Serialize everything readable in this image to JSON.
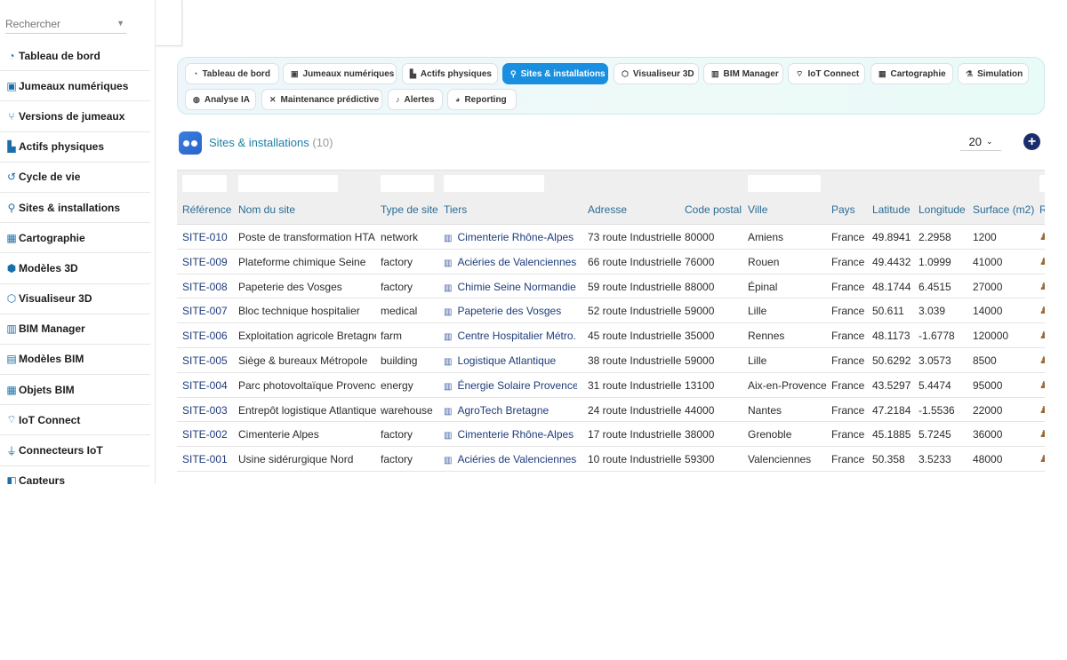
{
  "sidebar": {
    "search_placeholder": "Rechercher",
    "items": [
      {
        "label": "Tableau de bord",
        "icon": "dashboard-icon",
        "glyph": "◔"
      },
      {
        "label": "Jumeaux numériques",
        "icon": "digital-twin-icon",
        "glyph": "▣"
      },
      {
        "label": "Versions de jumeaux",
        "icon": "branch-icon",
        "glyph": "⑂"
      },
      {
        "label": "Actifs physiques",
        "icon": "industry-icon",
        "glyph": "▙"
      },
      {
        "label": "Cycle de vie",
        "icon": "history-icon",
        "glyph": "↺"
      },
      {
        "label": "Sites & installations",
        "icon": "map-pin-icon",
        "glyph": "⚲"
      },
      {
        "label": "Cartographie",
        "icon": "map-icon",
        "glyph": "▦"
      },
      {
        "label": "Modèles 3D",
        "icon": "cube-icon",
        "glyph": "⬢"
      },
      {
        "label": "Visualiseur 3D",
        "icon": "cubes-icon",
        "glyph": "⬡"
      },
      {
        "label": "BIM Manager",
        "icon": "building-icon",
        "glyph": "▥"
      },
      {
        "label": "Modèles BIM",
        "icon": "city-icon",
        "glyph": "▤"
      },
      {
        "label": "Objets BIM",
        "icon": "grid-icon",
        "glyph": "▦"
      },
      {
        "label": "IoT Connect",
        "icon": "broadcast-icon",
        "glyph": "⌔"
      },
      {
        "label": "Connecteurs IoT",
        "icon": "plug-icon",
        "glyph": "⏚"
      },
      {
        "label": "Capteurs",
        "icon": "sensor-icon",
        "glyph": "◧"
      }
    ]
  },
  "tabs": [
    {
      "label": "Tableau de bord",
      "icon": "dashboard-icon",
      "glyph": "◔",
      "active": false
    },
    {
      "label": "Jumeaux numériques",
      "icon": "digital-twin-icon",
      "glyph": "▣",
      "active": false
    },
    {
      "label": "Actifs physiques",
      "icon": "industry-icon",
      "glyph": "▙",
      "active": false
    },
    {
      "label": "Sites & installations",
      "icon": "map-pin-icon",
      "glyph": "⚲",
      "active": true
    },
    {
      "label": "Visualiseur 3D",
      "icon": "cubes-icon",
      "glyph": "⬡",
      "active": false
    },
    {
      "label": "BIM Manager",
      "icon": "building-icon",
      "glyph": "▥",
      "active": false
    },
    {
      "label": "IoT Connect",
      "icon": "broadcast-icon",
      "glyph": "⌔",
      "active": false
    },
    {
      "label": "Cartographie",
      "icon": "map-icon",
      "glyph": "▦",
      "active": false
    },
    {
      "label": "Simulation",
      "icon": "flask-icon",
      "glyph": "⚗",
      "active": false
    },
    {
      "label": "Analyse IA",
      "icon": "brain-icon",
      "glyph": "◍",
      "active": false
    },
    {
      "label": "Maintenance prédictive",
      "icon": "tools-icon",
      "glyph": "✕",
      "active": false
    },
    {
      "label": "Alertes",
      "icon": "bell-icon",
      "glyph": "♪",
      "active": false
    },
    {
      "label": "Reporting",
      "icon": "chart-pie-icon",
      "glyph": "◕",
      "active": false
    }
  ],
  "page": {
    "title": "Sites & installations",
    "count": "(10)",
    "page_size": "20",
    "add_label": "+"
  },
  "table": {
    "columns": [
      "Référence",
      "Nom du site",
      "Type de site",
      "Tiers",
      "Adresse",
      "Code postal",
      "Ville",
      "Pays",
      "Latitude",
      "Longitude",
      "Surface (m2)",
      "R"
    ],
    "rows": [
      {
        "ref": "SITE-010",
        "name": "Poste de transformation HTA",
        "type": "network",
        "tiers": "Cimenterie Rhône-Alpes",
        "address": "73 route Industrielle",
        "cp": "80000",
        "city": "Amiens",
        "country": "France",
        "lat": "49.8941",
        "lon": "2.2958",
        "surface": "1200"
      },
      {
        "ref": "SITE-009",
        "name": "Plateforme chimique Seine",
        "type": "factory",
        "tiers": "Aciéries de Valenciennes",
        "address": "66 route Industrielle",
        "cp": "76000",
        "city": "Rouen",
        "country": "France",
        "lat": "49.4432",
        "lon": "1.0999",
        "surface": "41000"
      },
      {
        "ref": "SITE-008",
        "name": "Papeterie des Vosges",
        "type": "factory",
        "tiers": "Chimie Seine Normandie",
        "address": "59 route Industrielle",
        "cp": "88000",
        "city": "Épinal",
        "country": "France",
        "lat": "48.1744",
        "lon": "6.4515",
        "surface": "27000"
      },
      {
        "ref": "SITE-007",
        "name": "Bloc technique hospitalier",
        "type": "medical",
        "tiers": "Papeterie des Vosges",
        "address": "52 route Industrielle",
        "cp": "59000",
        "city": "Lille",
        "country": "France",
        "lat": "50.611",
        "lon": "3.039",
        "surface": "14000"
      },
      {
        "ref": "SITE-006",
        "name": "Exploitation agricole Bretagne",
        "type": "farm",
        "tiers": "Centre Hospitalier Métro...",
        "address": "45 route Industrielle",
        "cp": "35000",
        "city": "Rennes",
        "country": "France",
        "lat": "48.1173",
        "lon": "-1.6778",
        "surface": "120000"
      },
      {
        "ref": "SITE-005",
        "name": "Siège & bureaux Métropole",
        "type": "building",
        "tiers": "Logistique Atlantique",
        "address": "38 route Industrielle",
        "cp": "59000",
        "city": "Lille",
        "country": "France",
        "lat": "50.6292",
        "lon": "3.0573",
        "surface": "8500"
      },
      {
        "ref": "SITE-004",
        "name": "Parc photovoltaïque Provence",
        "type": "energy",
        "tiers": "Énergie Solaire Provence",
        "address": "31 route Industrielle",
        "cp": "13100",
        "city": "Aix-en-Provence",
        "country": "France",
        "lat": "43.5297",
        "lon": "5.4474",
        "surface": "95000"
      },
      {
        "ref": "SITE-003",
        "name": "Entrepôt logistique Atlantique",
        "type": "warehouse",
        "tiers": "AgroTech Bretagne",
        "address": "24 route Industrielle",
        "cp": "44000",
        "city": "Nantes",
        "country": "France",
        "lat": "47.2184",
        "lon": "-1.5536",
        "surface": "22000"
      },
      {
        "ref": "SITE-002",
        "name": "Cimenterie Alpes",
        "type": "factory",
        "tiers": "Cimenterie Rhône-Alpes",
        "address": "17 route Industrielle",
        "cp": "38000",
        "city": "Grenoble",
        "country": "France",
        "lat": "45.1885",
        "lon": "5.7245",
        "surface": "36000"
      },
      {
        "ref": "SITE-001",
        "name": "Usine sidérurgique Nord",
        "type": "factory",
        "tiers": "Aciéries de Valenciennes",
        "address": "10 route Industrielle",
        "cp": "59300",
        "city": "Valenciennes",
        "country": "France",
        "lat": "50.358",
        "lon": "3.5233",
        "surface": "48000"
      }
    ]
  }
}
